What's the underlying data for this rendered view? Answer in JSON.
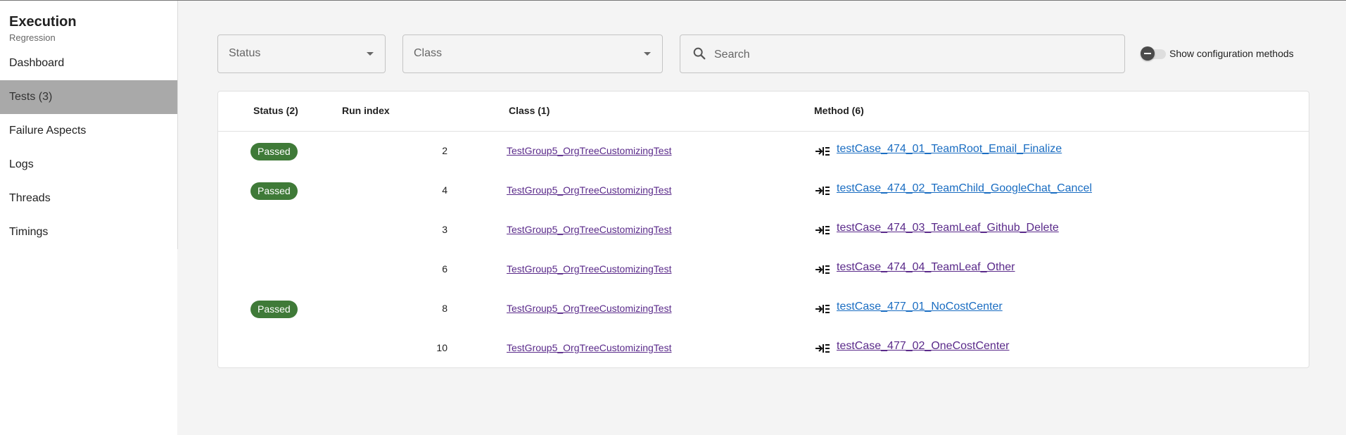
{
  "app": {
    "title": "Execution",
    "subtitle": "Regression"
  },
  "sidebar": {
    "items": [
      {
        "label": "Dashboard",
        "active": false
      },
      {
        "label": "Tests (3)",
        "active": true
      },
      {
        "label": "Failure Aspects",
        "active": false
      },
      {
        "label": "Logs",
        "active": false
      },
      {
        "label": "Threads",
        "active": false
      },
      {
        "label": "Timings",
        "active": false
      }
    ]
  },
  "filters": {
    "status_label": "Status",
    "class_label": "Class",
    "search_placeholder": "Search",
    "search_value": "",
    "toggle_label": "Show configuration methods",
    "toggle_on": false
  },
  "table": {
    "headers": {
      "status": "Status (2)",
      "run_index": "Run index",
      "class": "Class (1)",
      "method": "Method (6)"
    },
    "rows": [
      {
        "status": "Passed",
        "run_index": "2",
        "class": "TestGroup5_OrgTreeCustomizingTest",
        "method": "testCase_474_01_TeamRoot_Email_Finalize",
        "method_color": "#1a6dc2"
      },
      {
        "status": "Passed",
        "run_index": "4",
        "class": "TestGroup5_OrgTreeCustomizingTest",
        "method": "testCase_474_02_TeamChild_GoogleChat_Cancel",
        "method_color": "#1a6dc2"
      },
      {
        "status": "",
        "run_index": "3",
        "class": "TestGroup5_OrgTreeCustomizingTest",
        "method": "testCase_474_03_TeamLeaf_Github_Delete",
        "method_color": "#5a2a8a"
      },
      {
        "status": "",
        "run_index": "6",
        "class": "TestGroup5_OrgTreeCustomizingTest",
        "method": "testCase_474_04_TeamLeaf_Other",
        "method_color": "#5a2a8a"
      },
      {
        "status": "Passed",
        "run_index": "8",
        "class": "TestGroup5_OrgTreeCustomizingTest",
        "method": "testCase_477_01_NoCostCenter",
        "method_color": "#1a6dc2"
      },
      {
        "status": "",
        "run_index": "10",
        "class": "TestGroup5_OrgTreeCustomizingTest",
        "method": "testCase_477_02_OneCostCenter",
        "method_color": "#5a2a8a"
      }
    ]
  },
  "colors": {
    "passed_badge": "#3f7a38",
    "active_nav": "#a9a9a9",
    "visited_link": "#5a2a8a",
    "link": "#1a6dc2"
  },
  "icons": {
    "search": "search-icon",
    "method": "method-step-icon",
    "dropdown": "chevron-down-icon"
  }
}
